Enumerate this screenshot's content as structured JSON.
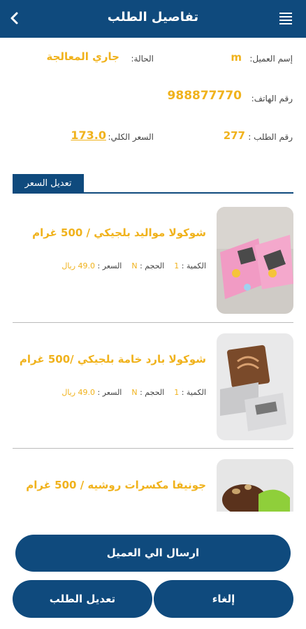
{
  "header": {
    "title": "تفاصيل الطلب"
  },
  "info": {
    "customer_label": "إسم العميل:",
    "customer_value": "m",
    "status_label": "الحالة:",
    "status_value": "جاري المعالجة",
    "phone_label": "رقم الهاتف:",
    "phone_value": "988877770",
    "order_no_label": "رقم الطلب :",
    "order_no_value": "277",
    "total_label": "السعر الكلي:",
    "total_value": "173.0"
  },
  "edit_price_tab": "تعديل السعر",
  "items": [
    {
      "name": "شوكولا مواليد بلجيكي / 500 غرام",
      "qty_label": "الكمية :",
      "qty": "1",
      "size_label": "الحجم :",
      "size": "N",
      "price_label": "السعر :",
      "price": "49.0 ريال"
    },
    {
      "name": "شوكولا بارد خامة بلجيكي /500 غرام",
      "qty_label": "الكمية :",
      "qty": "1",
      "size_label": "الحجم :",
      "size": "N",
      "price_label": "السعر :",
      "price": "49.0 ريال"
    },
    {
      "name": "جونيفا مكسرات روشيه / 500 غرام"
    }
  ],
  "buttons": {
    "send": "ارسال الي العميل",
    "edit_order": "تعديل الطلب",
    "cancel": "إلغاء"
  },
  "colors": {
    "primary": "#0f4a7d",
    "accent": "#f0b21c"
  }
}
